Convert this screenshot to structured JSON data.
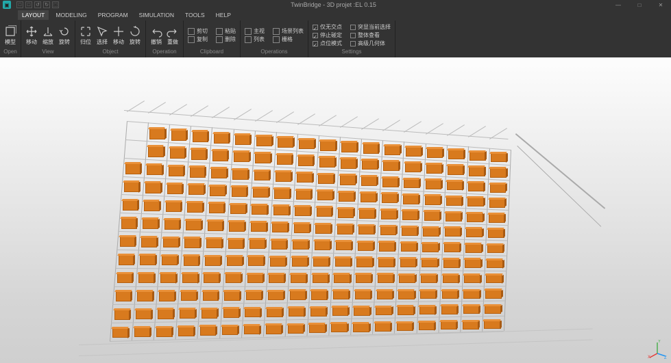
{
  "titlebar": {
    "title": "TwinBridge - 3D projet :EL 0.15",
    "quick": [
      "□",
      "□",
      "↺",
      "↻",
      "⬚"
    ]
  },
  "window_controls": {
    "min": "—",
    "max": "□",
    "close": "✕"
  },
  "menu": {
    "items": [
      {
        "label": "LAYOUT",
        "active": true
      },
      {
        "label": "MODELING"
      },
      {
        "label": "PROGRAM"
      },
      {
        "label": "SIMULATION"
      },
      {
        "label": "TOOLS"
      },
      {
        "label": "HELP"
      }
    ]
  },
  "ribbon": {
    "groups": [
      {
        "name": "open",
        "label": "Open",
        "buttons": [
          {
            "id": "model",
            "label": "模型"
          }
        ]
      },
      {
        "name": "view",
        "label": "View",
        "buttons": [
          {
            "id": "move",
            "label": "移动"
          },
          {
            "id": "scale",
            "label": "缩放"
          },
          {
            "id": "rotate",
            "label": "旋转"
          }
        ]
      },
      {
        "name": "object",
        "label": "Object",
        "buttons": [
          {
            "id": "fit",
            "label": "归位"
          },
          {
            "id": "select",
            "label": "选择"
          },
          {
            "id": "move2",
            "label": "移动"
          },
          {
            "id": "rot2",
            "label": "旋转"
          }
        ]
      },
      {
        "name": "operation",
        "label": "Operation",
        "buttons": [
          {
            "id": "undo",
            "label": "撤销"
          },
          {
            "id": "redo",
            "label": "重做"
          }
        ]
      },
      {
        "name": "clipboard",
        "label": "Clipboard",
        "items": [
          {
            "id": "cut",
            "label": "剪切"
          },
          {
            "id": "copy",
            "label": "复制"
          },
          {
            "id": "paste",
            "label": "粘贴"
          },
          {
            "id": "delete",
            "label": "删除"
          }
        ]
      },
      {
        "name": "operations",
        "label": "Operations",
        "items": [
          {
            "id": "top",
            "label": "主视"
          },
          {
            "id": "list",
            "label": "列表"
          },
          {
            "id": "scenelist",
            "label": "场景列表"
          },
          {
            "id": "grid",
            "label": "栅格"
          }
        ]
      },
      {
        "name": "settings",
        "label": "Settings",
        "items": [
          {
            "id": "r1a",
            "label": "仅无交点",
            "checked": true
          },
          {
            "id": "r1b",
            "label": "突显当前选择",
            "checked": false
          },
          {
            "id": "r2a",
            "label": "停止碰定",
            "checked": true
          },
          {
            "id": "r2b",
            "label": "整体查看",
            "checked": false
          },
          {
            "id": "r3a",
            "label": "点位模式",
            "checked": true
          },
          {
            "id": "r3b",
            "label": "高级几何体",
            "checked": false
          }
        ]
      }
    ]
  },
  "gizmo": {
    "x": "X",
    "y": "Y",
    "z": "Z"
  }
}
